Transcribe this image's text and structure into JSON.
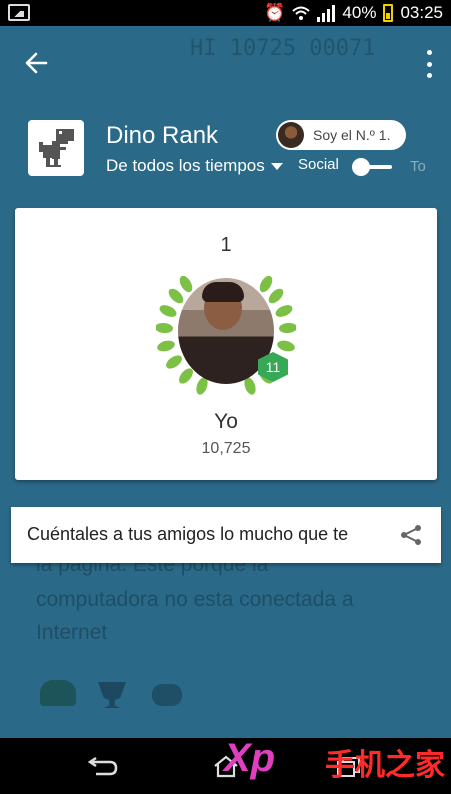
{
  "status_bar": {
    "battery": "40%",
    "time": "03:25"
  },
  "header": {
    "title": "Dino Rank",
    "time_filter": "De todos los tiempos",
    "social_label": "Social",
    "faded_label": "To",
    "badge_label": "Soy el N.º 1."
  },
  "card": {
    "rank": "1",
    "level": "11",
    "player_name": "Yo",
    "score": "10,725"
  },
  "share": {
    "text": "Cuéntales a tus amigos lo mucho que te"
  },
  "background": {
    "top_digits": "HI  10725  00071",
    "line1": "la pagina. Este porque la",
    "line2": "computadora no esta conectada a",
    "line3": "Internet"
  },
  "watermark": {
    "xp": "Xp",
    "cn": "手机之家"
  },
  "colors": {
    "app_background": "#2a6a88",
    "level_badge": "#36a856",
    "laurel": "#7cc046"
  }
}
